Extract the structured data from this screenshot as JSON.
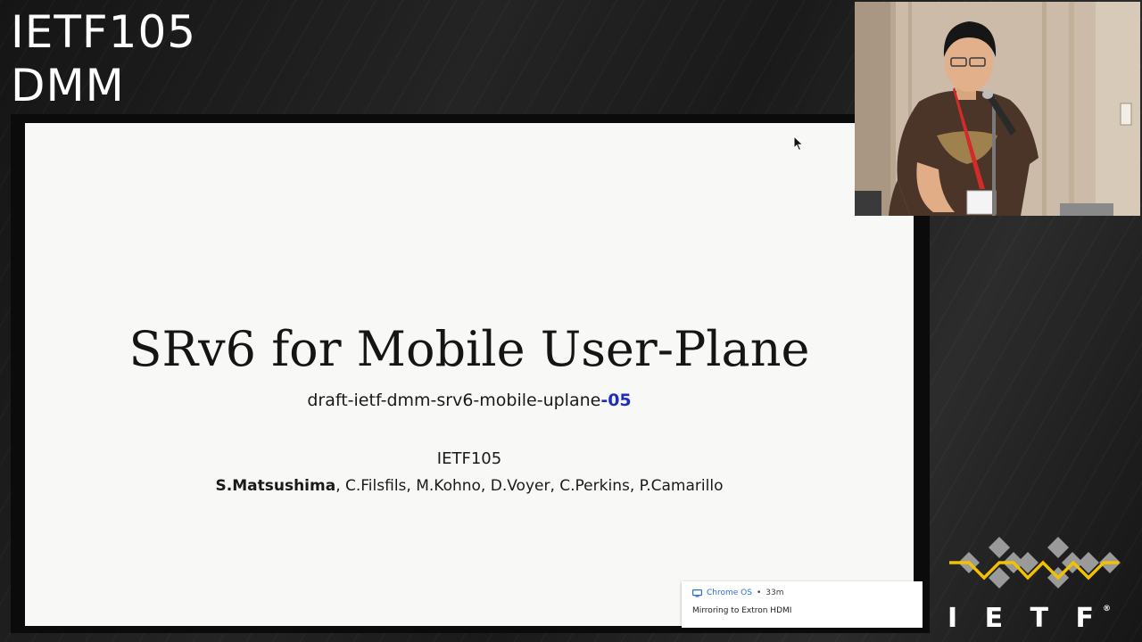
{
  "overlay": {
    "line1": "IETF105",
    "line2": "DMM"
  },
  "slide": {
    "title": "SRv6 for Mobile User-Plane",
    "draft_prefix": "draft-ietf-dmm-srv6-mobile-uplane",
    "draft_version": "-05",
    "event": "IETF105",
    "lead_author": "S.Matsushima",
    "other_authors": ", C.Filsfils, M.Kohno, D.Voyer, C.Perkins, P.Camarillo"
  },
  "notification": {
    "icon": "monitor-icon",
    "app": "Chrome OS",
    "separator": "•",
    "time": "33m",
    "message": "Mirroring to Extron HDMI"
  },
  "logo": {
    "text": "I E T F",
    "registered": "®",
    "colors": {
      "diamond": "#9a9a9a",
      "line": "#f2c200"
    }
  },
  "colors": {
    "slide_bg": "#f8f8f6",
    "version_accent": "#1f2fb8",
    "notification_app": "#2a6fd6"
  }
}
